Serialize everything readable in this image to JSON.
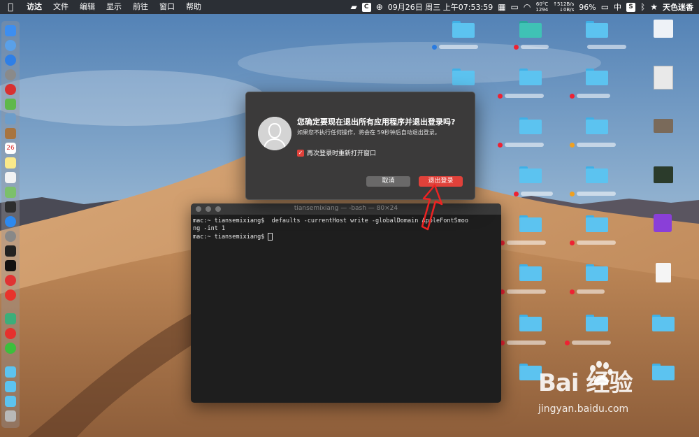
{
  "menubar": {
    "apple": "",
    "app": "访达",
    "items": [
      "文件",
      "编辑",
      "显示",
      "前往",
      "窗口",
      "帮助"
    ],
    "status": {
      "temp": "60°C",
      "temp2": "1294",
      "net_up": "↑512B/s",
      "net_down": "↓0B/s",
      "clock": "09月26日 周三 上午07:53:59",
      "battery": "96%",
      "input_method": "中",
      "user": "天色迷香"
    }
  },
  "dialog": {
    "title": "您确定要现在退出所有应用程序并退出登录吗?",
    "message": "如果您不执行任何操作，将会在 59秒钟后自动退出登录。",
    "reopen_label": "再次登录时重新打开窗口",
    "cancel_label": "取消",
    "logout_label": "退出登录"
  },
  "terminal": {
    "title": "tiansemixiang — -bash — 80×24",
    "lines": [
      "mac:~ tiansemixiang$  defaults -currentHost write -globalDomain AppleFontSmoo",
      "ng -int 1",
      "mac:~ tiansemixiang$ "
    ]
  },
  "watermark": {
    "logo": "Bai  经验",
    "url": "jingyan.baidu.com"
  },
  "colors": {
    "accent_red": "#e0413a",
    "folder_blue": "#5cc3f0"
  }
}
